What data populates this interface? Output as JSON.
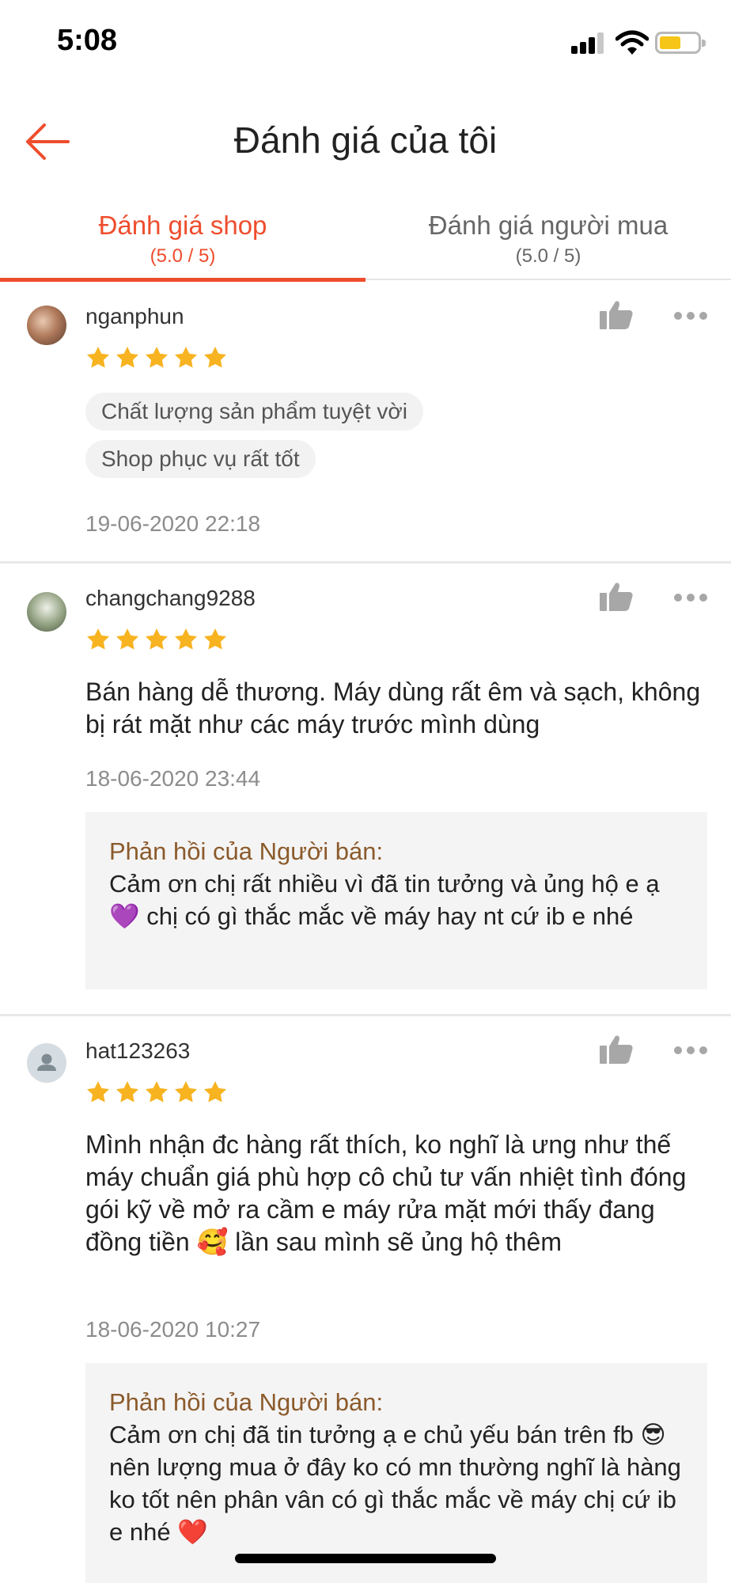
{
  "status_bar": {
    "time": "5:08",
    "battery_level": 0.45
  },
  "header": {
    "title": "Đánh giá của tôi",
    "back_icon": "arrow-left-icon"
  },
  "tabs": [
    {
      "label": "Đánh giá shop",
      "sub": "(5.0 / 5)",
      "active": true
    },
    {
      "label": "Đánh giá người mua",
      "sub": "(5.0 / 5)",
      "active": false
    }
  ],
  "colors": {
    "accent": "#ee4d2d",
    "star": "#f7b320",
    "reply_label": "#8b5a2b"
  },
  "reviews": [
    {
      "username": "nganphun",
      "rating": 5,
      "tags": [
        "Chất lượng sản phẩm tuyệt vời",
        "Shop phục vụ rất tốt"
      ],
      "comment": "",
      "date": "19-06-2020 22:18"
    },
    {
      "username": "changchang9288",
      "rating": 5,
      "comment": "Bán hàng dễ thương. Máy dùng rất êm và sạch, không bị rát mặt như các máy trước mình dùng",
      "date": "18-06-2020 23:44",
      "reply": {
        "label": "Phản hồi của Người bán:",
        "text": "Cảm ơn chị rất nhiều vì đã tin tưởng và ủng hộ e ạ 💜 chị có gì thắc mắc về máy hay nt cứ ib e nhé"
      }
    },
    {
      "username": "hat123263",
      "rating": 5,
      "comment": "Mình nhận đc hàng rất thích, ko nghĩ là ưng như thế máy chuẩn giá phù hợp cô chủ tư vấn nhiệt tình đóng gói kỹ về mở ra cầm e máy rửa mặt mới thấy đang đồng tiền 🥰 lần sau mình sẽ ủng hộ thêm",
      "date": "18-06-2020 10:27",
      "reply": {
        "label": "Phản hồi của Người bán:",
        "text": "Cảm ơn chị đã tin tưởng ạ e chủ yếu bán trên fb 😎 nên lượng mua ở đây ko có mn thường nghĩ là hàng ko tốt nên phân vân có gì thắc mắc về máy chị cứ ib e nhé ❤️"
      }
    }
  ]
}
